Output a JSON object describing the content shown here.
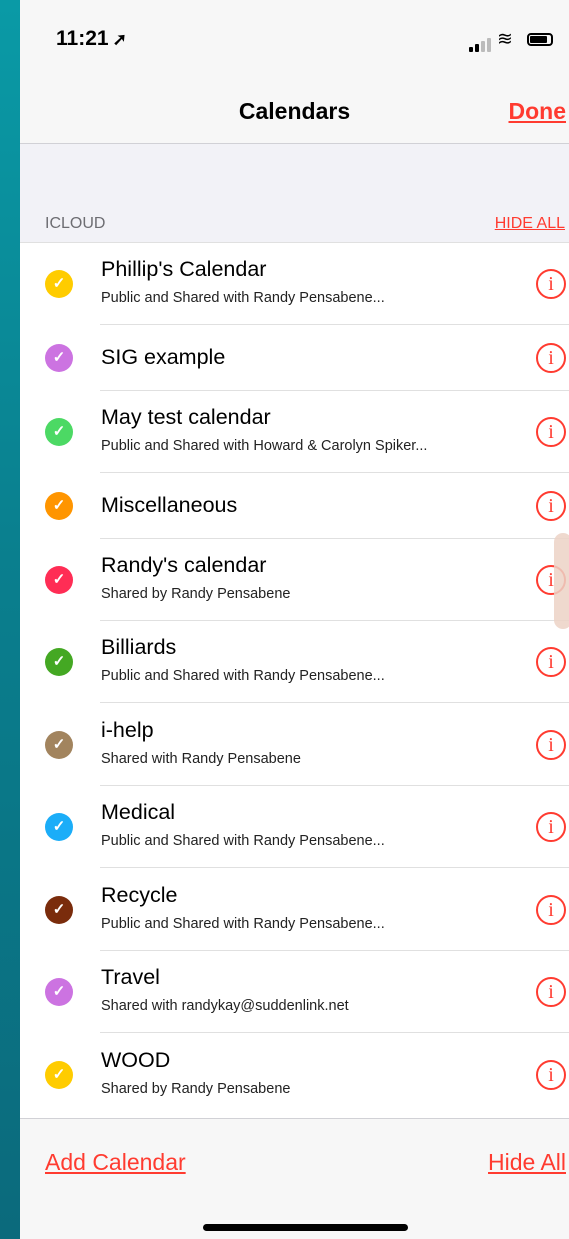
{
  "status": {
    "time": "11:21"
  },
  "nav": {
    "title": "Calendars",
    "done": "Done"
  },
  "section": {
    "label": "ICLOUD",
    "hide_all": "HIDE ALL"
  },
  "calendars": [
    {
      "name": "Phillip's Calendar",
      "subtitle": "Public and Shared with Randy Pensabene...",
      "color": "#ffcc00"
    },
    {
      "name": "SIG example",
      "subtitle": "",
      "color": "#cc73e1"
    },
    {
      "name": "May test calendar",
      "subtitle": "Public and Shared with Howard & Carolyn Spiker...",
      "color": "#4cd964"
    },
    {
      "name": "Miscellaneous",
      "subtitle": "",
      "color": "#ff9500"
    },
    {
      "name": "Randy's calendar",
      "subtitle": "Shared by Randy Pensabene",
      "color": "#ff2d55"
    },
    {
      "name": "Billiards",
      "subtitle": "Public and Shared with Randy Pensabene...",
      "color": "#44a823"
    },
    {
      "name": "i-help",
      "subtitle": "Shared with Randy Pensabene",
      "color": "#a2845e"
    },
    {
      "name": "Medical",
      "subtitle": "Public and Shared with Randy Pensabene...",
      "color": "#1badf8"
    },
    {
      "name": "Recycle",
      "subtitle": "Public and Shared with Randy Pensabene...",
      "color": "#7a2c0c"
    },
    {
      "name": "Travel",
      "subtitle": "Shared with randykay@suddenlink.net",
      "color": "#cc73e1"
    },
    {
      "name": "WOOD",
      "subtitle": "Shared by Randy Pensabene",
      "color": "#ffcc00"
    }
  ],
  "toolbar": {
    "add_calendar": "Add Calendar",
    "hide_all": "Hide All"
  },
  "icons": {
    "check": "checkmark-icon",
    "info": "info-icon",
    "wifi": "wifi-icon",
    "signal": "signal-icon",
    "battery": "battery-icon",
    "location": "location-arrow-icon"
  }
}
